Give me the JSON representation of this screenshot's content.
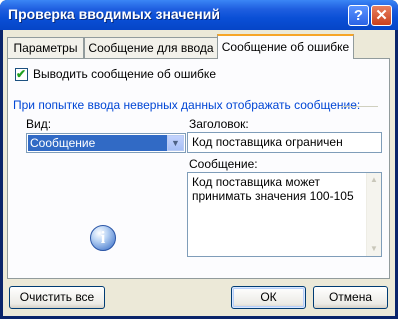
{
  "window": {
    "title": "Проверка вводимых значений",
    "help_label": "?",
    "close_label": "✕"
  },
  "tabs": [
    {
      "label": "Параметры"
    },
    {
      "label": "Сообщение для ввода"
    },
    {
      "label": "Сообщение об ошибке"
    }
  ],
  "error_tab": {
    "show_checkbox_label": "Выводить сообщение об ошибке",
    "show_checkbox_checked": true,
    "group_label": "При попытке ввода неверных данных отображать сообщение:",
    "style_label": "Вид:",
    "style_value": "Сообщение",
    "title_label": "Заголовок:",
    "title_value": "Код поставщика ограничен",
    "message_label": "Сообщение:",
    "message_value": "Код поставщика может принимать значения 100-105",
    "icon": "info-icon"
  },
  "buttons": {
    "clear_all": "Очистить все",
    "ok": "ОК",
    "cancel": "Отмена"
  }
}
